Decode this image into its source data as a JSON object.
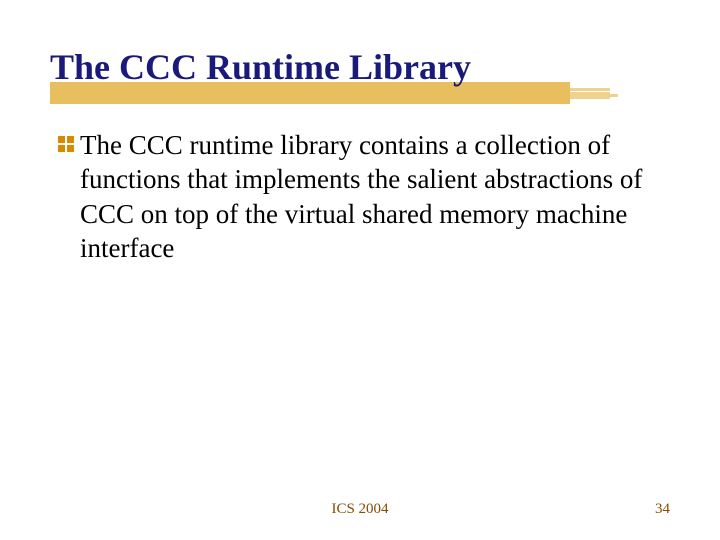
{
  "slide": {
    "title": "The CCC Runtime Library",
    "bullet_text": "The CCC runtime library contains a collection of functions that implements the salient abstractions of CCC on top of the virtual shared memory machine interface"
  },
  "footer": {
    "center": "ICS 2004",
    "page": "34"
  },
  "colors": {
    "title": "#1a1a7a",
    "brush": "#e6b84d",
    "bullet": "#d68b00",
    "footer": "#8a4a00"
  }
}
